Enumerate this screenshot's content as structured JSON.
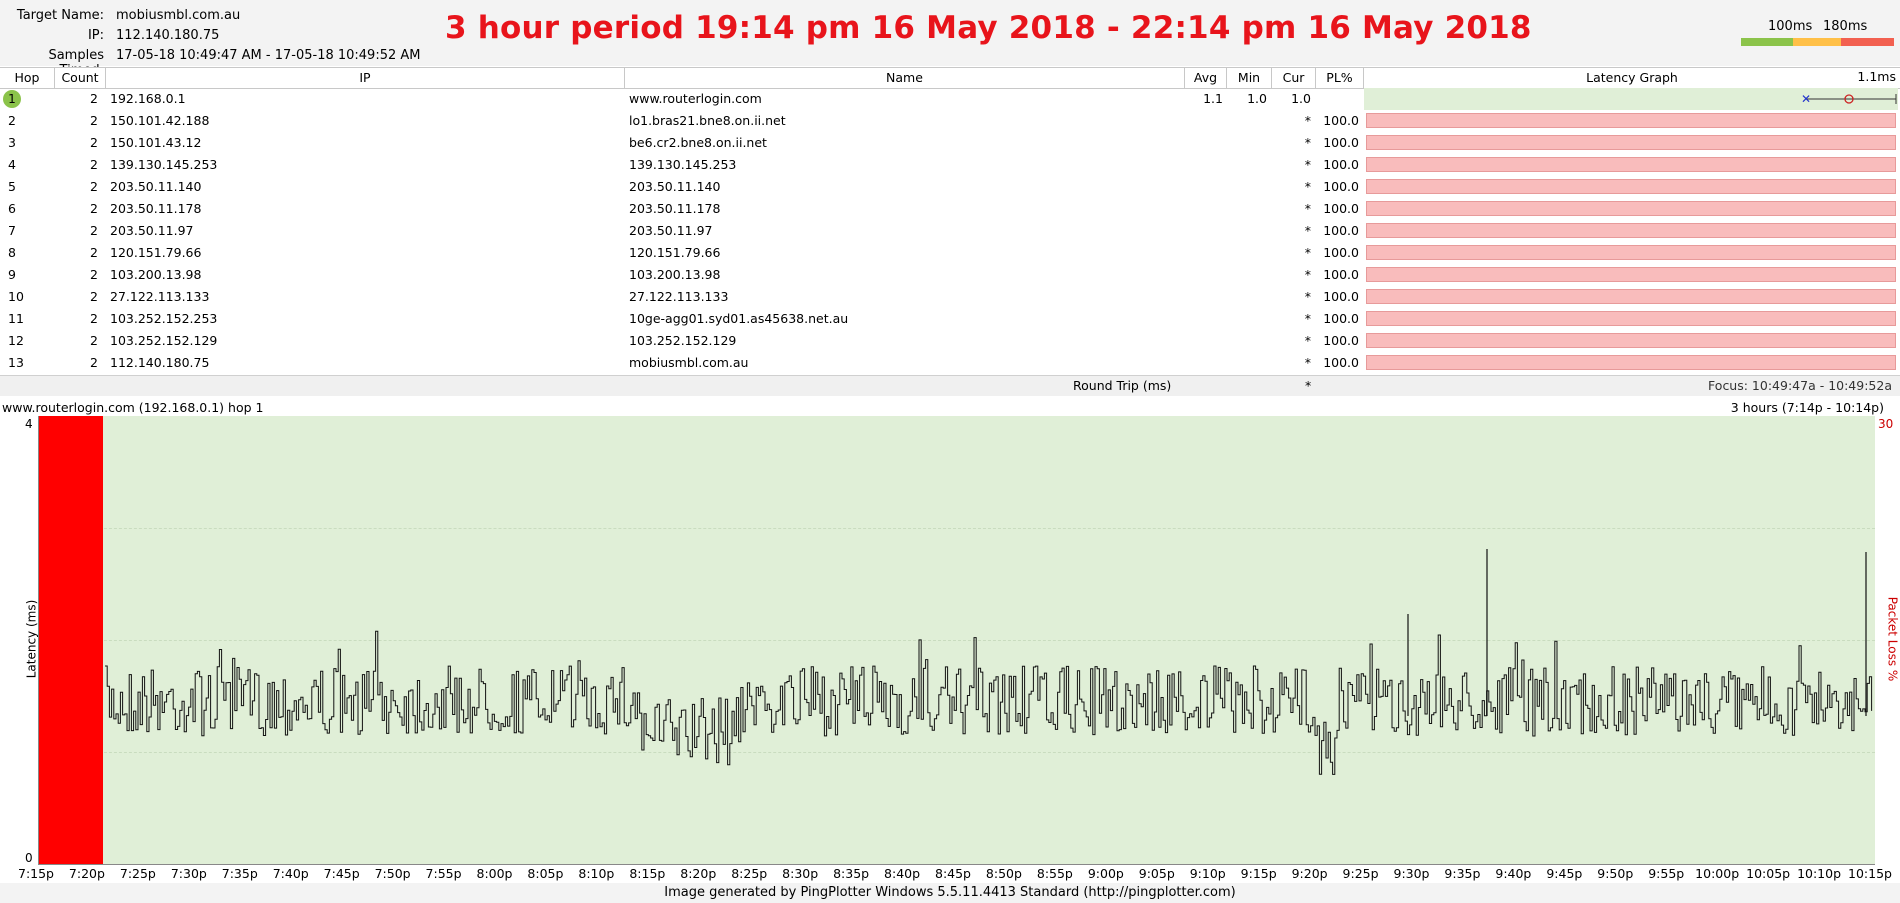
{
  "header": {
    "target_label": "Target Name:",
    "target_value": "mobiusmbl.com.au",
    "ip_label": "IP:",
    "ip_value": "112.140.180.75",
    "samples_label": "Samples Timed:",
    "samples_value": "17-05-18 10:49:47 AM - 17-05-18 10:49:52 AM",
    "period_title": "3 hour period 19:14 pm 16 May 2018 - 22:14 pm 16 May 2018",
    "legend_100": "100ms",
    "legend_180": "180ms",
    "colors": {
      "good": "#8bc34a",
      "warn": "#ffc048",
      "bad": "#f26050"
    }
  },
  "table": {
    "columns": [
      "Hop",
      "Count",
      "IP",
      "Name",
      "Avg",
      "Min",
      "Cur",
      "PL%",
      "Latency Graph"
    ],
    "latency_scale_label": "1.1ms",
    "rows": [
      {
        "hop": "1",
        "count": "2",
        "ip": "192.168.0.1",
        "name": "www.routerlogin.com",
        "avg": "1.1",
        "min": "1.0",
        "cur": "1.0",
        "pl": ""
      },
      {
        "hop": "2",
        "count": "2",
        "ip": "150.101.42.188",
        "name": "lo1.bras21.bne8.on.ii.net",
        "avg": "",
        "min": "",
        "cur": "*",
        "pl": "100.0"
      },
      {
        "hop": "3",
        "count": "2",
        "ip": "150.101.43.12",
        "name": "be6.cr2.bne8.on.ii.net",
        "avg": "",
        "min": "",
        "cur": "*",
        "pl": "100.0"
      },
      {
        "hop": "4",
        "count": "2",
        "ip": "139.130.145.253",
        "name": "139.130.145.253",
        "avg": "",
        "min": "",
        "cur": "*",
        "pl": "100.0"
      },
      {
        "hop": "5",
        "count": "2",
        "ip": "203.50.11.140",
        "name": "203.50.11.140",
        "avg": "",
        "min": "",
        "cur": "*",
        "pl": "100.0"
      },
      {
        "hop": "6",
        "count": "2",
        "ip": "203.50.11.178",
        "name": "203.50.11.178",
        "avg": "",
        "min": "",
        "cur": "*",
        "pl": "100.0"
      },
      {
        "hop": "7",
        "count": "2",
        "ip": "203.50.11.97",
        "name": "203.50.11.97",
        "avg": "",
        "min": "",
        "cur": "*",
        "pl": "100.0"
      },
      {
        "hop": "8",
        "count": "2",
        "ip": "120.151.79.66",
        "name": "120.151.79.66",
        "avg": "",
        "min": "",
        "cur": "*",
        "pl": "100.0"
      },
      {
        "hop": "9",
        "count": "2",
        "ip": "103.200.13.98",
        "name": "103.200.13.98",
        "avg": "",
        "min": "",
        "cur": "*",
        "pl": "100.0"
      },
      {
        "hop": "10",
        "count": "2",
        "ip": "27.122.113.133",
        "name": "27.122.113.133",
        "avg": "",
        "min": "",
        "cur": "*",
        "pl": "100.0"
      },
      {
        "hop": "11",
        "count": "2",
        "ip": "103.252.152.253",
        "name": "10ge-agg01.syd01.as45638.net.au",
        "avg": "",
        "min": "",
        "cur": "*",
        "pl": "100.0"
      },
      {
        "hop": "12",
        "count": "2",
        "ip": "103.252.152.129",
        "name": "103.252.152.129",
        "avg": "",
        "min": "",
        "cur": "*",
        "pl": "100.0"
      },
      {
        "hop": "13",
        "count": "2",
        "ip": "112.140.180.75",
        "name": "mobiusmbl.com.au",
        "avg": "",
        "min": "",
        "cur": "*",
        "pl": "100.0"
      }
    ],
    "round_trip_label": "Round Trip (ms)",
    "round_trip_cur": "*",
    "focus_text": "Focus: 10:49:47a - 10:49:52a"
  },
  "graph": {
    "title_left": "www.routerlogin.com (192.168.0.1) hop 1",
    "title_right": "3 hours (7:14p - 10:14p)",
    "y_left_label": "Latency (ms)",
    "y_right_label": "Packet Loss %",
    "y_top": "4",
    "y_bottom": "0",
    "pl_top": "30",
    "x_ticks": [
      "7:15p",
      "7:20p",
      "7:25p",
      "7:30p",
      "7:35p",
      "7:40p",
      "7:45p",
      "7:50p",
      "7:55p",
      "8:00p",
      "8:05p",
      "8:10p",
      "8:15p",
      "8:20p",
      "8:25p",
      "8:30p",
      "8:35p",
      "8:40p",
      "8:45p",
      "8:50p",
      "8:55p",
      "9:00p",
      "9:05p",
      "9:10p",
      "9:15p",
      "9:20p",
      "9:25p",
      "9:30p",
      "9:35p",
      "9:40p",
      "9:45p",
      "9:50p",
      "9:55p",
      "10:00p",
      "10:05p",
      "10:10p",
      "10:15p"
    ]
  },
  "footer": "Image generated by PingPlotter Windows 5.5.11.4413 Standard (http://pingplotter.com)"
}
